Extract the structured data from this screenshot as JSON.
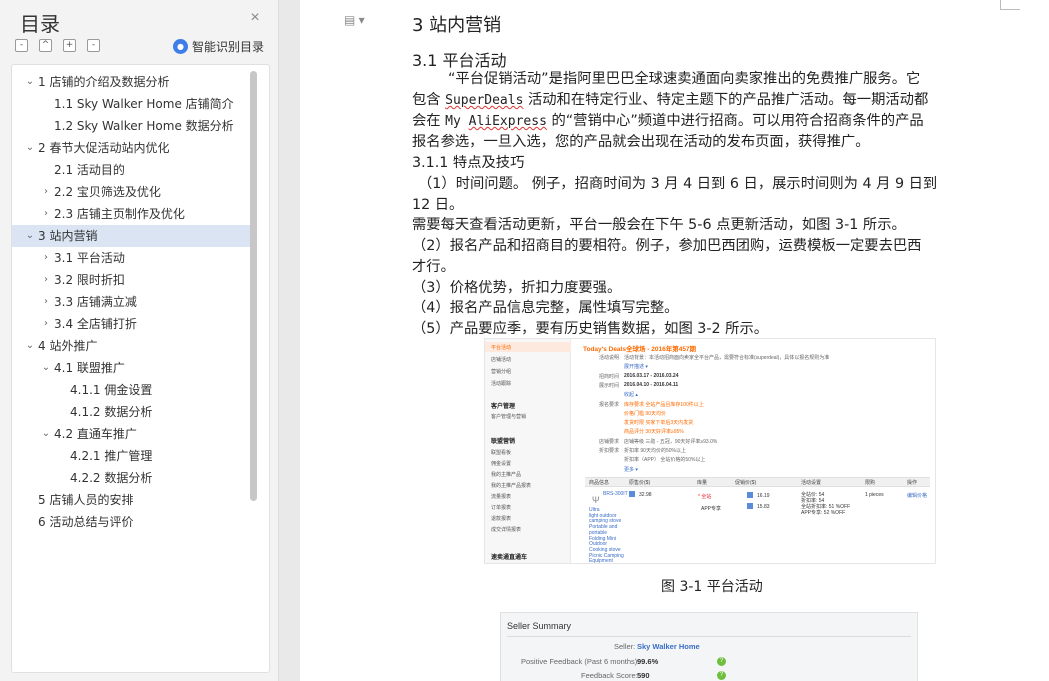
{
  "outline": {
    "title": "目录",
    "close_icon": "×",
    "toolbar": {
      "collapse_all": "-",
      "collapse": "^",
      "expand": "+",
      "remove": "-"
    },
    "smart_label": "智能识别目录",
    "items": [
      {
        "label": "1 店铺的介绍及数据分析",
        "chevron": "⌄"
      },
      {
        "label": "1.1 Sky Walker Home 店铺简介",
        "chevron": ""
      },
      {
        "label": "1.2 Sky Walker Home 数据分析",
        "chevron": ""
      },
      {
        "label": "2 春节大促活动站内优化",
        "chevron": "⌄"
      },
      {
        "label": "2.1 活动目的",
        "chevron": ""
      },
      {
        "label": "2.2 宝贝筛选及优化",
        "chevron": "›"
      },
      {
        "label": "2.3 店铺主页制作及优化",
        "chevron": "›"
      },
      {
        "label": "3 站内营销",
        "chevron": "⌄"
      },
      {
        "label": "3.1 平台活动",
        "chevron": "›"
      },
      {
        "label": "3.2 限时折扣",
        "chevron": "›"
      },
      {
        "label": "3.3 店铺满立减",
        "chevron": "›"
      },
      {
        "label": "3.4 全店铺打折",
        "chevron": "›"
      },
      {
        "label": "4 站外推广",
        "chevron": "⌄"
      },
      {
        "label": "4.1 联盟推广",
        "chevron": "⌄"
      },
      {
        "label": "4.1.1  佣金设置",
        "chevron": ""
      },
      {
        "label": "4.1.2  数据分析",
        "chevron": ""
      },
      {
        "label": "4.2 直通车推广",
        "chevron": "⌄"
      },
      {
        "label": "4.2.1 推广管理",
        "chevron": ""
      },
      {
        "label": "4.2.2 数据分析",
        "chevron": ""
      },
      {
        "label": "5 店铺人员的安排",
        "chevron": ""
      },
      {
        "label": "6 活动总结与评价",
        "chevron": ""
      }
    ]
  },
  "page_tool_icon": "▤ ▾",
  "doc": {
    "h1": "3 站内营销",
    "h2": "3.1 平台活动",
    "p1_line1": "“平台促销活动”是指阿里巴巴全球速卖通面向卖家推出的免费推广服务。它",
    "p1_line2_a": "包含 ",
    "p1_line2_b": "SuperDeals",
    "p1_line2_c": " 活动和在特定行业、特定主题下的产品推广活动。每一期活动都",
    "p1_line3_a": "会在 ",
    "p1_line3_b": "My ",
    "p1_line3_c": "AliExpress",
    "p1_line3_d": " 的“营销中心”频道中进行招商。可以用符合招商条件的产品",
    "p1_line4": "报名参选，一旦入选，您的产品就会出现在活动的发布页面，获得推广。",
    "h3": "3.1.1 特点及技巧",
    "l1": "（1）时间问题。 例子，招商时间为 3 月 4 日到 6 日，展示时间则为 4 月 9 日到",
    "l1b": "12 日。",
    "l1c": "需要每天查看活动更新，平台一般会在下午 5-6 点更新活动，如图 3-1 所示。",
    "l2": "（2）报名产品和招商目的要相符。例子，参加巴西团购，运费模板一定要去巴西",
    "l2b": "才行。",
    "l3": "（3）价格优势，折扣力度要强。",
    "l4": "（4）报名产品信息完整，属性填写完整。",
    "l5": "（5）产品要应季，要有历史销售数据，如图 3-2 所示。"
  },
  "fig1": {
    "title": "Today's Deals全球场 - 2016年第457期",
    "side_items": [
      "平台活动",
      "店铺活动",
      "营销分组",
      "活动跟踪"
    ],
    "side_head1": "客户管理",
    "side_sub1": "客户管理与营销",
    "side_head2": "联盟营销",
    "side_sub2": [
      "联盟看板",
      "佣金设置",
      "我的主推产品",
      "我的主推产品报表",
      "流量报表",
      "订单报表",
      "退款报表",
      "成交详情报表"
    ],
    "side_head3": "速卖通直通车",
    "rows": [
      {
        "k": "活动说明",
        "v": "活动背景：本活动招商面向卖家全平台产品，需要符合标准(superdeal)，具体以报名规则为准"
      },
      {
        "k": "",
        "v": "展开描述 ▾"
      },
      {
        "k": "招商时间",
        "v": "2016.03.17 - 2016.03.24"
      },
      {
        "k": "展示时间",
        "v": "2016.04.10 - 2016.04.11"
      },
      {
        "k": "",
        "v": "收起 ▴"
      },
      {
        "k": "报名要求",
        "v": "库存要求  全站产品且库存100件以上"
      },
      {
        "k": "",
        "v": "价格门槛  90天均价"
      },
      {
        "k": "",
        "v": "发货时限  买家下单后3天内发货"
      },
      {
        "k": "",
        "v": "商品评分  30天好评率≥95%"
      },
      {
        "k": "店铺要求",
        "v": "店铺等级  三勋 - 五冠，90天好评率≥93.0%"
      },
      {
        "k": "折扣要求",
        "v": "折扣率  90天均价的50%以上"
      },
      {
        "k": "",
        "v": "折扣率（APP）  全站价格的50%以上"
      },
      {
        "k": "",
        "v": "更多 ▾"
      }
    ],
    "table_headers": [
      "商品信息",
      "原售价($)",
      "库量",
      "促销价($)",
      "活动设置",
      "限购",
      "操作"
    ],
    "product_code": "BRS-300IT",
    "product_desc": [
      "Ultra",
      "light outdoor",
      "camping stove",
      "Portable and",
      "portable",
      "Folding Mini",
      "Outdoor",
      "Cooking stove",
      "Picnic Camping",
      "Equipment"
    ],
    "price": "32.98",
    "stock": "* 全站",
    "stock_app": "APP专享",
    "promo1": "16.19",
    "promo2": "15.83",
    "setting1": "全站价: 54",
    "setting2": "折扣率: 54",
    "setting3": "全站折扣率: 51 %OFF",
    "setting4": "APP专享: 52 %OFF",
    "limit": "1 pieces",
    "action": "编辑价格",
    "caption": "图 3-1  平台活动"
  },
  "fig2": {
    "title": "Seller Summary",
    "seller_label": "Seller:",
    "seller_value": "Sky Walker Home",
    "pf_label": "Positive Feedback (Past 6 months):",
    "pf_value": "99.6%",
    "fs_label": "Feedback Score:",
    "fs_value": "590"
  },
  "colors": {
    "accent_orange": "#ff6a00",
    "link_blue": "#3a6dc7",
    "selected_bg": "#dbe4f3",
    "panel_bg": "#f3f3f4"
  }
}
